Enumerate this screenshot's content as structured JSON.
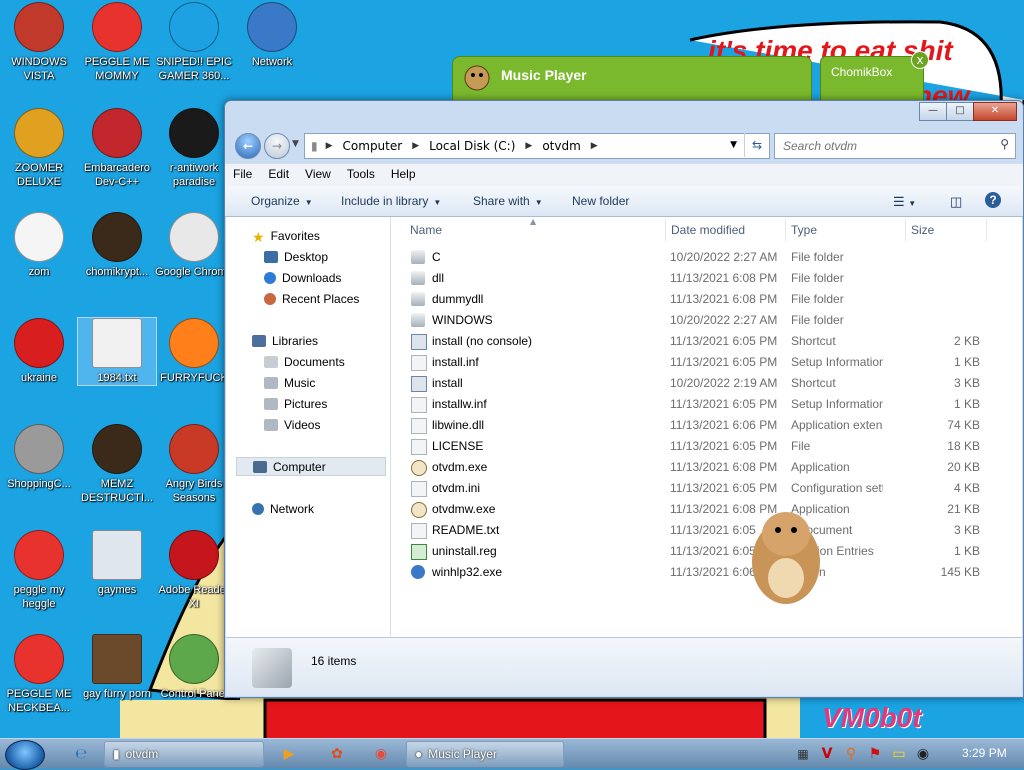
{
  "wallpaper": {
    "caption_line1": "it's time to eat shit",
    "caption_line2": "new"
  },
  "desktop_icons": [
    {
      "label": "WINDOWS VISTA",
      "icon": "globe-ball-icon"
    },
    {
      "label": "PEGGLE ME MOMMY",
      "icon": "peggle-icon"
    },
    {
      "label": "SNIPED!! EPIC GAMER 360...",
      "icon": "skype-icon"
    },
    {
      "label": "Network",
      "icon": "network-icon"
    },
    {
      "label": "ZOOMER DELUXE",
      "icon": "zuma-icon"
    },
    {
      "label": "Embarcadero Dev-C++",
      "icon": "devcpp-icon"
    },
    {
      "label": "r-antiwork paradise",
      "icon": "red-circle-icon"
    },
    {
      "label": "zom",
      "icon": "flower-icon"
    },
    {
      "label": "chomikrypt...",
      "icon": "hourglass-icon"
    },
    {
      "label": "Google Chrome",
      "icon": "chrome-icon"
    },
    {
      "label": "ukraine",
      "icon": "radiation-icon"
    },
    {
      "label": "1984.txt",
      "icon": "text-file-icon"
    },
    {
      "label": "FURRYFUCK",
      "icon": "firefox-icon"
    },
    {
      "label": "ShoppingC...",
      "icon": "flash-icon"
    },
    {
      "label": "MEMZ DESTRUCTI...",
      "icon": "hourglass-icon"
    },
    {
      "label": "Angry Birds Seasons",
      "icon": "angry-birds-icon"
    },
    {
      "label": "peggle my heggle",
      "icon": "peggle-icon"
    },
    {
      "label": "gaymes",
      "icon": "games-folder-icon"
    },
    {
      "label": "Adobe Reader XI",
      "icon": "adobe-reader-icon"
    },
    {
      "label": "PEGGLE ME NECKBEA...",
      "icon": "peggle-icon"
    },
    {
      "label": "gay fürry porn",
      "icon": "bonzi-box-icon"
    },
    {
      "label": "Control Panel",
      "icon": "control-panel-icon"
    }
  ],
  "music_player": {
    "title": "Music Player"
  },
  "chomik_box": {
    "title": "ChomikBox",
    "close": "x"
  },
  "explorer": {
    "breadcrumb": [
      "Computer",
      "Local Disk (C:)",
      "otvdm"
    ],
    "search_placeholder": "Search otvdm",
    "menu": [
      "File",
      "Edit",
      "View",
      "Tools",
      "Help"
    ],
    "toolbar": {
      "organize": "Organize",
      "include": "Include in library",
      "share": "Share with",
      "new_folder": "New folder"
    },
    "nav": {
      "favorites": "Favorites",
      "desktop": "Desktop",
      "downloads": "Downloads",
      "recent": "Recent Places",
      "libraries": "Libraries",
      "documents": "Documents",
      "music": "Music",
      "pictures": "Pictures",
      "videos": "Videos",
      "computer": "Computer",
      "network": "Network"
    },
    "columns": {
      "name": "Name",
      "date": "Date modified",
      "type": "Type",
      "size": "Size"
    },
    "files": [
      {
        "name": "C",
        "date": "10/20/2022 2:27 AM",
        "type": "File folder",
        "size": "",
        "kind": "folder"
      },
      {
        "name": "dll",
        "date": "11/13/2021 6:08 PM",
        "type": "File folder",
        "size": "",
        "kind": "folder"
      },
      {
        "name": "dummydll",
        "date": "11/13/2021 6:08 PM",
        "type": "File folder",
        "size": "",
        "kind": "folder"
      },
      {
        "name": "WINDOWS",
        "date": "10/20/2022 2:27 AM",
        "type": "File folder",
        "size": "",
        "kind": "folder"
      },
      {
        "name": "install (no console)",
        "date": "11/13/2021 6:05 PM",
        "type": "Shortcut",
        "size": "2 KB",
        "kind": "shortcut"
      },
      {
        "name": "install.inf",
        "date": "11/13/2021 6:05 PM",
        "type": "Setup Information",
        "size": "1 KB",
        "kind": "file"
      },
      {
        "name": "install",
        "date": "10/20/2022 2:19 AM",
        "type": "Shortcut",
        "size": "3 KB",
        "kind": "shortcut"
      },
      {
        "name": "installw.inf",
        "date": "11/13/2021 6:05 PM",
        "type": "Setup Information",
        "size": "1 KB",
        "kind": "file"
      },
      {
        "name": "libwine.dll",
        "date": "11/13/2021 6:06 PM",
        "type": "Application extens...",
        "size": "74 KB",
        "kind": "file"
      },
      {
        "name": "LICENSE",
        "date": "11/13/2021 6:05 PM",
        "type": "File",
        "size": "18 KB",
        "kind": "file"
      },
      {
        "name": "otvdm.exe",
        "date": "11/13/2021 6:08 PM",
        "type": "Application",
        "size": "20 KB",
        "kind": "exe"
      },
      {
        "name": "otvdm.ini",
        "date": "11/13/2021 6:05 PM",
        "type": "Configuration sett...",
        "size": "4 KB",
        "kind": "file"
      },
      {
        "name": "otvdmw.exe",
        "date": "11/13/2021 6:08 PM",
        "type": "Application",
        "size": "21 KB",
        "kind": "exe"
      },
      {
        "name": "README.txt",
        "date": "11/13/2021 6:05",
        "type": "t Document",
        "size": "3 KB",
        "kind": "file"
      },
      {
        "name": "uninstall.reg",
        "date": "11/13/2021 6:05",
        "type": "istration Entries",
        "size": "1 KB",
        "kind": "reg"
      },
      {
        "name": "winhlp32.exe",
        "date": "11/13/2021 6:06",
        "type": "ication",
        "size": "145 KB",
        "kind": "help"
      }
    ],
    "item_count": "16 items"
  },
  "taskbar": {
    "explorer_task": "otvdm",
    "music_task": "Music Player",
    "clock": "3:29 PM"
  },
  "watermark": "VM0b0t",
  "colors": {
    "desktop": "#1ba3e2",
    "accent": "#7ab82d",
    "selection": "#cfe3fa"
  }
}
